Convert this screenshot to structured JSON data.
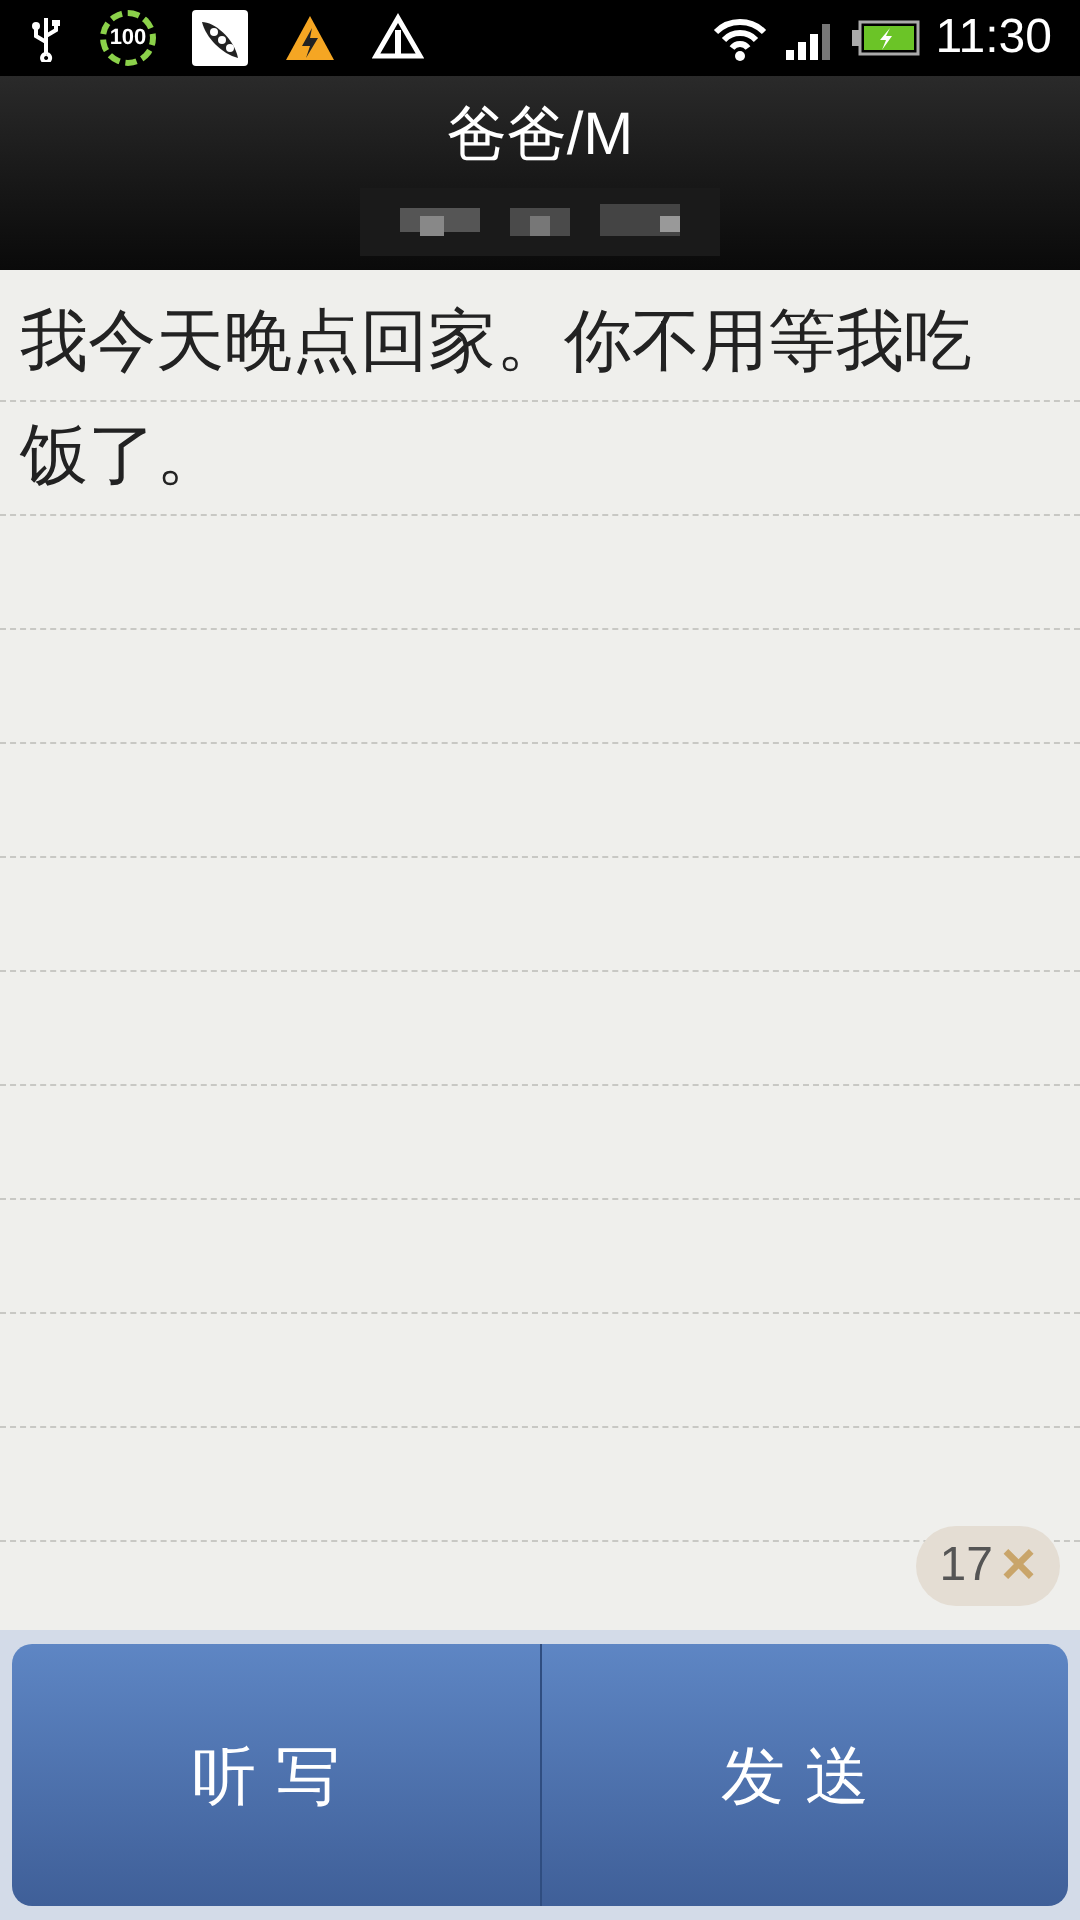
{
  "status_bar": {
    "battery_badge": "100",
    "time": "11:30"
  },
  "header": {
    "title": "爸爸/M"
  },
  "message": {
    "text": "我今天晚点回家。你不用等我吃饭了。",
    "counter": "17",
    "clear_symbol": "×"
  },
  "buttons": [
    {
      "label": "听写"
    },
    {
      "label": "发送"
    }
  ]
}
